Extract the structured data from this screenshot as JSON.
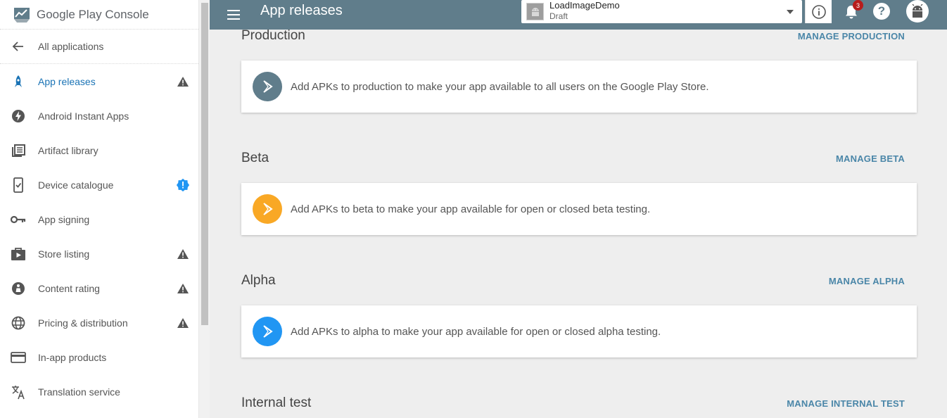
{
  "brand": {
    "name_prefix": "Google Play",
    "name_suffix": "Console"
  },
  "sidebar": {
    "back_label": "All applications",
    "items": [
      {
        "label": "App releases",
        "icon": "rocket-icon",
        "flag": "warning-icon",
        "active": true
      },
      {
        "label": "Android Instant Apps",
        "icon": "bolt-icon",
        "flag": ""
      },
      {
        "label": "Artifact library",
        "icon": "library-icon",
        "flag": ""
      },
      {
        "label": "Device catalogue",
        "icon": "device-check-icon",
        "flag": "info-badge-icon"
      },
      {
        "label": "App signing",
        "icon": "key-icon",
        "flag": ""
      },
      {
        "label": "Store listing",
        "icon": "store-play-icon",
        "flag": "warning-icon"
      },
      {
        "label": "Content rating",
        "icon": "rating-icon",
        "flag": "warning-icon"
      },
      {
        "label": "Pricing & distribution",
        "icon": "globe-icon",
        "flag": "warning-icon"
      },
      {
        "label": "In-app products",
        "icon": "credit-card-icon",
        "flag": ""
      },
      {
        "label": "Translation service",
        "icon": "translate-icon",
        "flag": ""
      }
    ]
  },
  "header": {
    "title": "App releases",
    "app_selector": {
      "name": "LoadImageDemo",
      "status": "Draft"
    },
    "notifications_count": "3"
  },
  "tracks": [
    {
      "title": "Production",
      "manage_label": "MANAGE PRODUCTION",
      "message": "Add APKs to production to make your app available to all users on the Google Play Store.",
      "icon_color": "#607d8b"
    },
    {
      "title": "Beta",
      "manage_label": "MANAGE BETA",
      "message": "Add APKs to beta to make your app available for open or closed beta testing.",
      "icon_color": "#f9a825"
    },
    {
      "title": "Alpha",
      "manage_label": "MANAGE ALPHA",
      "message": "Add APKs to alpha to make your app available for open or closed alpha testing.",
      "icon_color": "#2196f3"
    },
    {
      "title": "Internal test",
      "manage_label": "MANAGE INTERNAL TEST"
    }
  ],
  "colors": {
    "accent": "#607d8b",
    "link": "#4a86a8",
    "active": "#1a73b5",
    "badge": "#b71c1c"
  }
}
